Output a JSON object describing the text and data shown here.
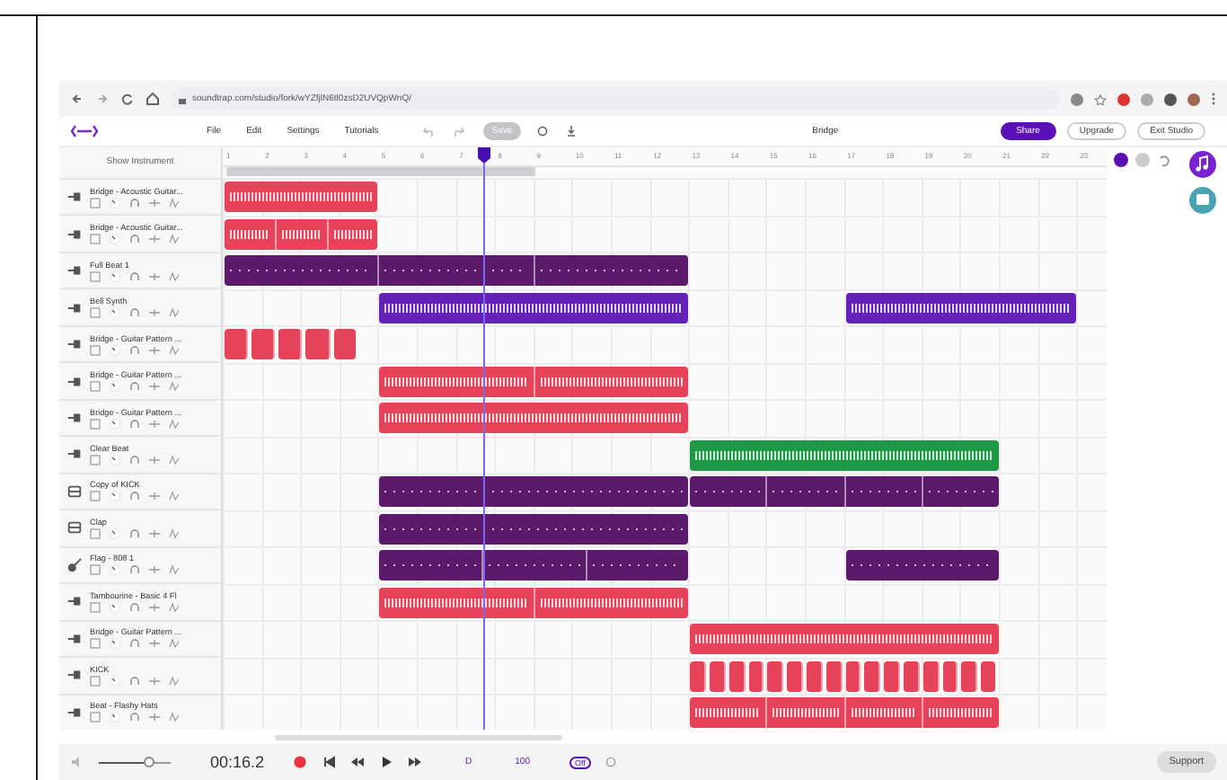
{
  "browser": {
    "url": "soundtrap.com/studio/fork/wYZfjlN6tl0zsD2UVQpWnQ/"
  },
  "menu": [
    "File",
    "Edit",
    "Settings",
    "Tutorials"
  ],
  "save": {
    "label": "Save",
    "disabled": true
  },
  "project_title": "Bridge",
  "actions": {
    "share": "Share",
    "upgrade": "Upgrade",
    "exit": "Exit Studio"
  },
  "show_instrument": "Show Instrument",
  "ruler": [
    "1",
    "2",
    "3",
    "4",
    "5",
    "6",
    "7",
    "8",
    "9",
    "10",
    "11",
    "12",
    "13",
    "14",
    "15",
    "16",
    "17",
    "18",
    "19",
    "20",
    "21",
    "22",
    "23"
  ],
  "tracks": [
    {
      "name": "Bridge - Acoustic Guitar...",
      "kind": "input",
      "clips": [
        {
          "kind": "audio",
          "color": "#e6435b"
        }
      ]
    },
    {
      "name": "Bridge - Acoustic Guitar...",
      "kind": "input",
      "clips": [
        {
          "kind": "audio",
          "color": "#e6435b"
        }
      ]
    },
    {
      "name": "Full Beat 1",
      "kind": "input",
      "clips": [
        {
          "kind": "midi",
          "color": "#5c1a6b"
        }
      ]
    },
    {
      "name": "Bell Synth",
      "kind": "input",
      "clips": [
        {
          "kind": "audio",
          "color": "#6422b8"
        },
        {
          "kind": "audio",
          "color": "#6422b8"
        }
      ]
    },
    {
      "name": "Bridge - Guitar Pattern ...",
      "kind": "input",
      "clips": [
        {
          "kind": "beats",
          "color": "#e6435b"
        }
      ]
    },
    {
      "name": "Bridge - Guitar Pattern ...",
      "kind": "input",
      "clips": [
        {
          "kind": "audio",
          "color": "#e6435b"
        }
      ]
    },
    {
      "name": "Bridge - Guitar Pattern ...",
      "kind": "input",
      "clips": [
        {
          "kind": "audio",
          "color": "#e6435b"
        }
      ]
    },
    {
      "name": "Clear Beat",
      "kind": "input",
      "clips": [
        {
          "kind": "audio",
          "color": "#1e9a47"
        }
      ]
    },
    {
      "name": "Copy of KICK",
      "kind": "drum",
      "clips": [
        {
          "kind": "midi",
          "color": "#5c1a6b"
        },
        {
          "kind": "midi",
          "color": "#5c1a6b"
        }
      ]
    },
    {
      "name": "Clap",
      "kind": "drum",
      "clips": [
        {
          "kind": "midi",
          "color": "#5c1a6b"
        }
      ]
    },
    {
      "name": "Flag - 808 1",
      "kind": "guitar",
      "clips": [
        {
          "kind": "midi",
          "color": "#5c1a6b"
        },
        {
          "kind": "midi",
          "color": "#5c1a6b"
        }
      ]
    },
    {
      "name": "Tambourine - Basic 4 Fl",
      "kind": "input",
      "clips": [
        {
          "kind": "audio",
          "color": "#e6435b"
        }
      ]
    },
    {
      "name": "Bridge - Guitar Pattern ...",
      "kind": "input",
      "clips": [
        {
          "kind": "audio",
          "color": "#e6435b"
        }
      ]
    },
    {
      "name": "KICK",
      "kind": "input",
      "clips": [
        {
          "kind": "beats",
          "color": "#e6435b"
        }
      ]
    },
    {
      "name": "Beat - Flashy Hats",
      "kind": "input",
      "clips": [
        {
          "kind": "audio",
          "color": "#e6435b"
        }
      ]
    }
  ],
  "transport": {
    "time": "00:16.2",
    "volume": {
      "level": 0.7
    },
    "key": "D",
    "tempo": "100",
    "metronome": "Off"
  },
  "support": "Support"
}
